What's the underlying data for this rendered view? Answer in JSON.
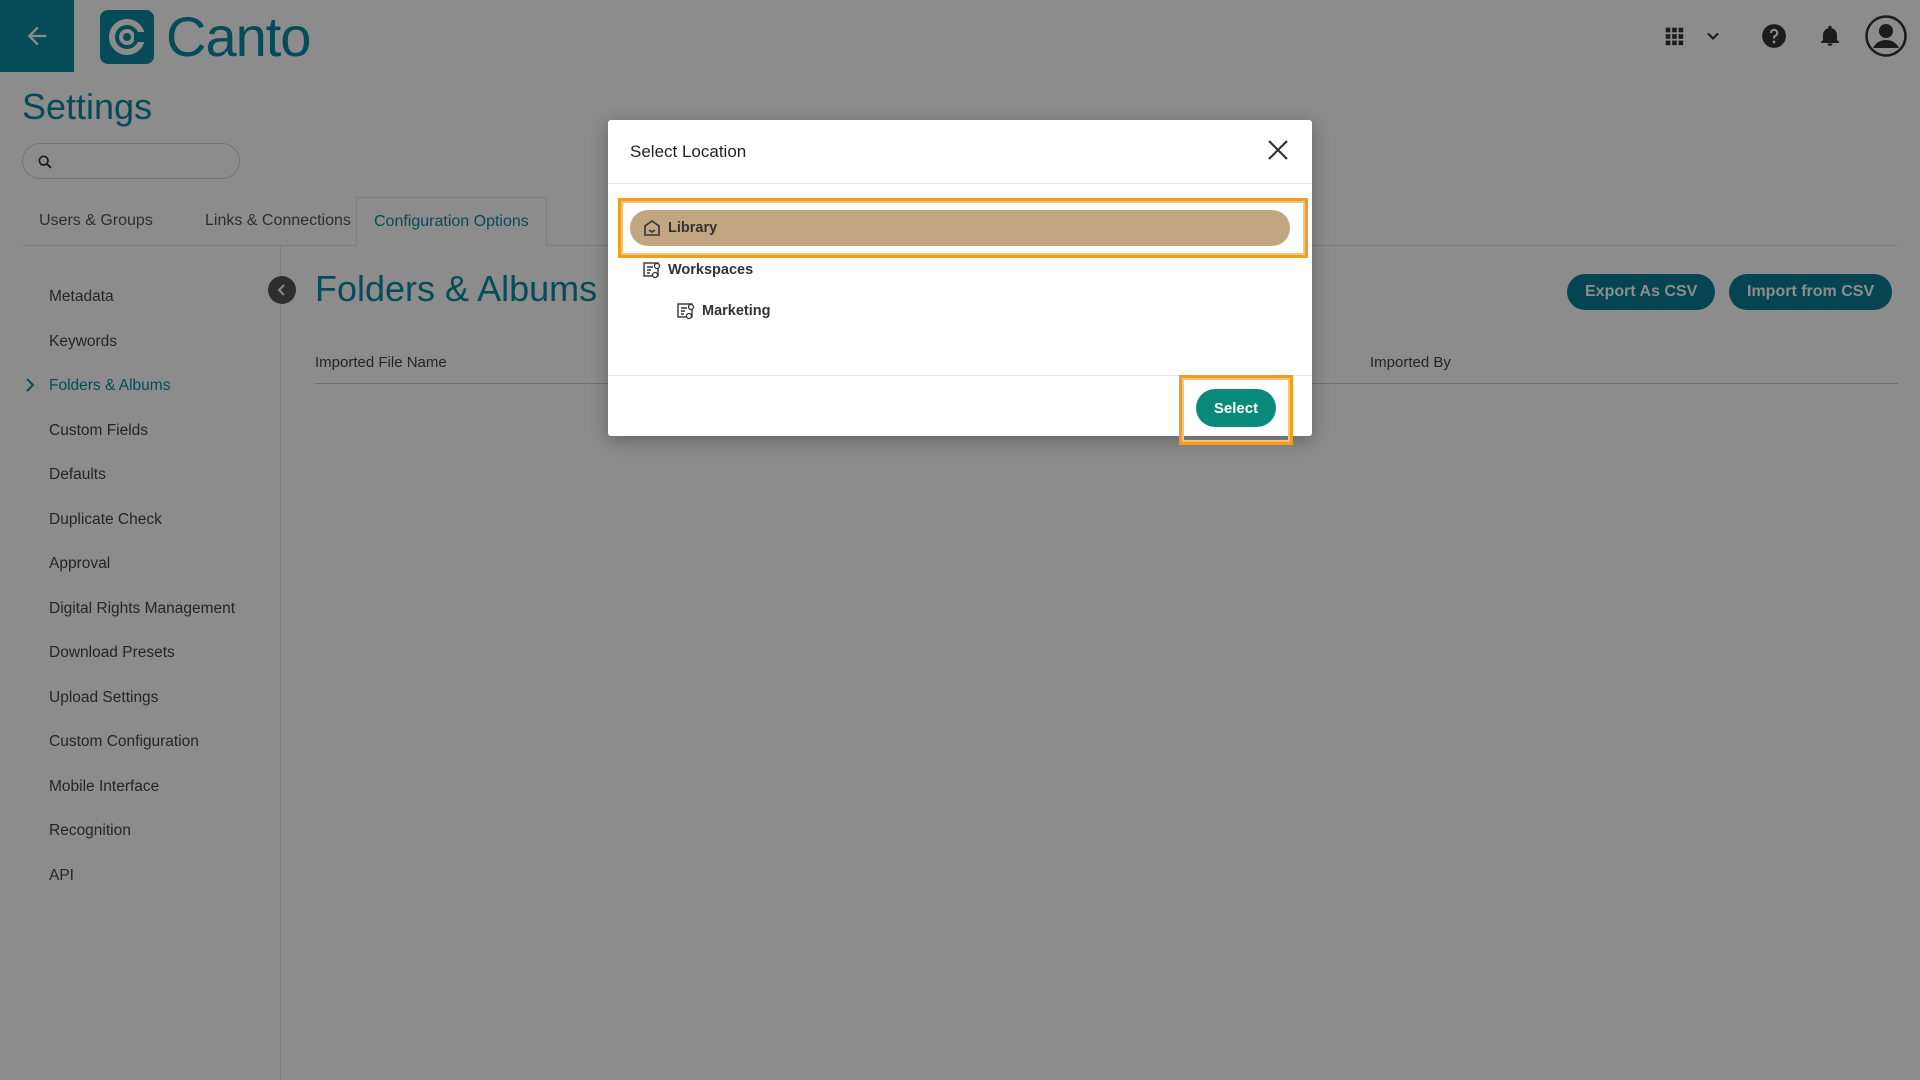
{
  "header": {
    "brand": "Canto",
    "icons": [
      "arrow-left-icon",
      "apps-grid-icon",
      "chevron-down-icon",
      "help-icon",
      "bell-icon",
      "avatar-icon"
    ]
  },
  "page": {
    "title": "Settings",
    "search_placeholder": ""
  },
  "tabs": [
    {
      "label": "Users & Groups",
      "active": false
    },
    {
      "label": "Links & Connections",
      "active": false
    },
    {
      "label": "Configuration Options",
      "active": true
    }
  ],
  "sidebar": {
    "items": [
      {
        "label": "Metadata"
      },
      {
        "label": "Keywords"
      },
      {
        "label": "Folders & Albums",
        "active": true
      },
      {
        "label": "Custom Fields"
      },
      {
        "label": "Defaults"
      },
      {
        "label": "Duplicate Check"
      },
      {
        "label": "Approval"
      },
      {
        "label": "Digital Rights Management"
      },
      {
        "label": "Download Presets"
      },
      {
        "label": "Upload Settings"
      },
      {
        "label": "Custom Configuration"
      },
      {
        "label": "Mobile Interface"
      },
      {
        "label": "Recognition"
      },
      {
        "label": "API"
      }
    ]
  },
  "main": {
    "title": "Folders & Albums",
    "export_label": "Export As CSV",
    "import_label": "Import from CSV",
    "columns": [
      "Imported File Name",
      "Imported By"
    ]
  },
  "modal": {
    "title": "Select Location",
    "tree": [
      {
        "label": "Library",
        "icon": "library-icon",
        "selected": true
      },
      {
        "label": "Workspaces",
        "icon": "workspace-icon",
        "selected": false
      },
      {
        "label": "Marketing",
        "icon": "workspace-icon",
        "selected": false
      }
    ],
    "select_label": "Select"
  },
  "colors": {
    "brand": "#0a8aa0",
    "primary_button": "#0a7f95",
    "select_button": "#0a8a7a",
    "selected_row": "#c2a682",
    "highlight": "#f39c1f"
  }
}
